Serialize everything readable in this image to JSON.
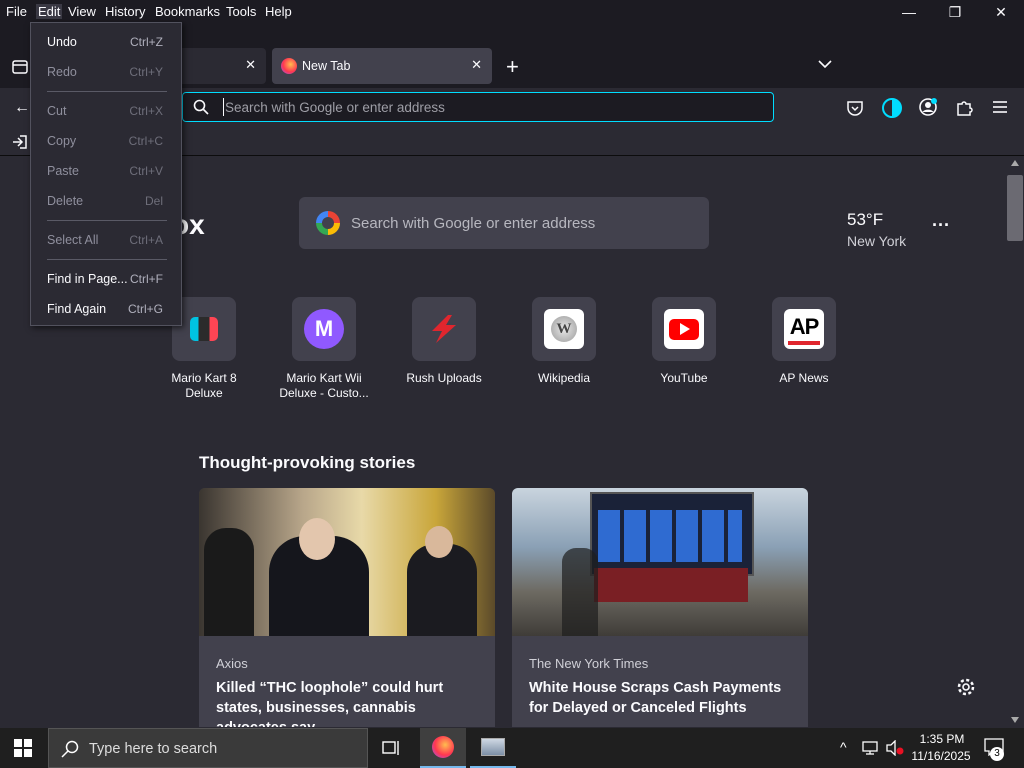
{
  "menubar": {
    "items": [
      "File",
      "Edit",
      "View",
      "History",
      "Bookmarks",
      "Tools",
      "Help"
    ]
  },
  "window_controls": {
    "minimize": "—",
    "restore": "❐",
    "close": "✕"
  },
  "tabs": [
    {
      "label": "",
      "active": false
    },
    {
      "label": "New Tab",
      "active": true
    }
  ],
  "urlbar": {
    "placeholder": "Search with Google or enter address"
  },
  "edit_menu": {
    "items": [
      {
        "label": "Undo",
        "shortcut": "Ctrl+Z",
        "disabled": false
      },
      {
        "label": "Redo",
        "shortcut": "Ctrl+Y",
        "disabled": true
      },
      {
        "label": "Cut",
        "shortcut": "Ctrl+X",
        "disabled": true
      },
      {
        "label": "Copy",
        "shortcut": "Ctrl+C",
        "disabled": true
      },
      {
        "label": "Paste",
        "shortcut": "Ctrl+V",
        "disabled": true
      },
      {
        "label": "Delete",
        "shortcut": "Del",
        "disabled": true
      },
      {
        "label": "Select All",
        "shortcut": "Ctrl+A",
        "disabled": true
      },
      {
        "label": "Find in Page...",
        "shortcut": "Ctrl+F",
        "disabled": false
      },
      {
        "label": "Find Again",
        "shortcut": "Ctrl+G",
        "disabled": false
      }
    ]
  },
  "newtab": {
    "logo_partial": "ox",
    "search_placeholder": "Search with Google or enter address",
    "weather": {
      "temp": "53°F",
      "city": "New York"
    },
    "shortcuts": [
      {
        "label1": "Mario Kart 8",
        "label2": "Deluxe"
      },
      {
        "label1": "Mario Kart Wii",
        "label2": "Deluxe - Custo..."
      },
      {
        "label1": "Rush Uploads",
        "label2": ""
      },
      {
        "label1": "Wikipedia",
        "label2": ""
      },
      {
        "label1": "YouTube",
        "label2": ""
      },
      {
        "label1": "AP News",
        "label2": ""
      }
    ],
    "stories_heading": "Thought-provoking stories",
    "stories": [
      {
        "source": "Axios",
        "headline": "Killed “THC loophole” could hurt states, businesses, cannabis advocates say"
      },
      {
        "source": "The New York Times",
        "headline": "White House Scraps Cash Payments for Delayed or Canceled Flights"
      }
    ]
  },
  "taskbar": {
    "search_placeholder": "Type here to search",
    "time": "1:35 PM",
    "date": "11/16/2025",
    "notifications": "3"
  },
  "colors": {
    "accent": "#00ddff",
    "bg": "#2b2a33",
    "chrome": "#1c1b22"
  }
}
